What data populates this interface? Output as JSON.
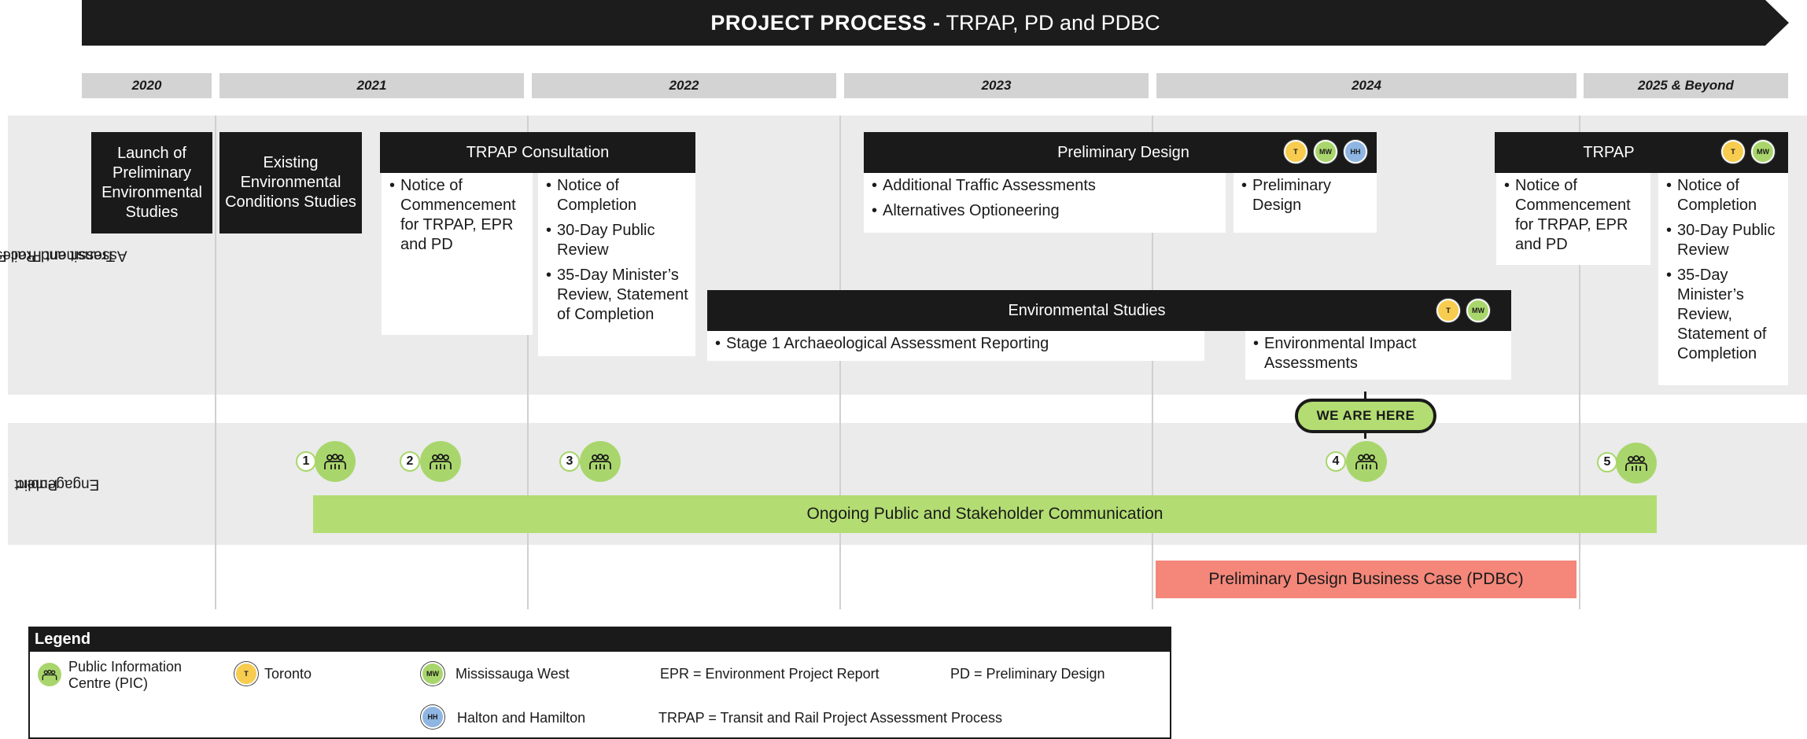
{
  "title": {
    "bold": "PROJECT PROCESS -",
    "rest": " TRPAP, PD and PDBC"
  },
  "years": [
    "2020",
    "2021",
    "2022",
    "2023",
    "2024",
    "2025 & Beyond"
  ],
  "bands": {
    "trpap_label_line1": "Transit and Rail Project",
    "trpap_label_line2": "Assessment Process",
    "engagement_label_line1": "Public",
    "engagement_label_line2": "Engagement"
  },
  "blocks": {
    "launch": "Launch of Preliminary Environmental Studies",
    "existing": "Existing Environmental Conditions Studies",
    "trpap_consultation": {
      "header": "TRPAP Consultation",
      "left_items": [
        "Notice of Commencement for TRPAP, EPR and PD"
      ],
      "right_items": [
        "Notice of Completion",
        "30-Day Public Review",
        "35-Day Minister’s Review, Statement of Completion"
      ]
    },
    "preliminary_design": {
      "header": "Preliminary Design",
      "badges": [
        "T",
        "MW",
        "HH"
      ],
      "left_items": [
        "Additional Traffic Assessments",
        "Alternatives Optioneering"
      ],
      "right_items": [
        "Preliminary Design"
      ]
    },
    "environmental_studies": {
      "header": "Environmental Studies",
      "badges": [
        "T",
        "MW"
      ],
      "left_items": [
        "Stage 1 Archaeological Assessment Reporting"
      ],
      "right_items": [
        "Environmental Impact Assessments"
      ]
    },
    "trpap": {
      "header": "TRPAP",
      "badges": [
        "T",
        "MW"
      ],
      "left_items": [
        "Notice of Commencement for TRPAP, EPR and PD"
      ],
      "right_items": [
        "Notice of Completion",
        "30-Day Public Review",
        "35-Day Minister’s Review, Statement of Completion"
      ]
    }
  },
  "pics": [
    "1",
    "2",
    "3",
    "4",
    "5"
  ],
  "we_are_here": "WE ARE HERE",
  "ongoing": "Ongoing Public and Stakeholder Communication",
  "pdbc": "Preliminary Design Business Case (PDBC)",
  "legend": {
    "title": "Legend",
    "pic_line1": "Public Information",
    "pic_line2": "Centre (PIC)",
    "toronto": "Toronto",
    "toronto_badge": "T",
    "mississauga": "Mississauga West",
    "mississauga_badge": "MW",
    "halton": "Halton and Hamilton",
    "halton_badge": "HH",
    "epr": "EPR = Environment Project Report",
    "pd": "PD = Preliminary Design",
    "trpap": "TRPAP = Transit and Rail Project Assessment Process"
  },
  "colors": {
    "toronto": "#f7cc4f",
    "mississauga": "#a9d66c",
    "halton": "#8fb6e3",
    "green": "#b3dd72",
    "pdbc": "#f4877a",
    "dark": "#1a1a1a"
  }
}
